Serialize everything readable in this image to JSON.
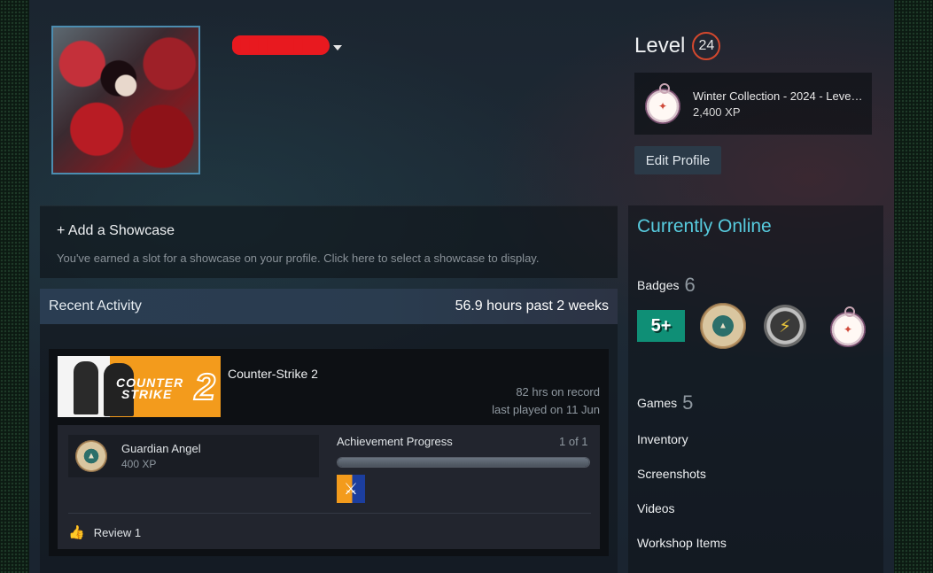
{
  "header": {
    "username": "████████",
    "level_label": "Level",
    "level_value": "24",
    "featured_badge": {
      "name": "Winter Collection - 2024 - Leve…",
      "xp": "2,400 XP",
      "icon": "compass-icon"
    },
    "edit_profile_label": "Edit Profile"
  },
  "showcase": {
    "title": "+ Add a Showcase",
    "description": "You've earned a slot for a showcase on your profile. Click here to select a showcase to display."
  },
  "recent_activity": {
    "title": "Recent Activity",
    "hours_summary": "56.9 hours past 2 weeks",
    "game": {
      "name": "Counter-Strike 2",
      "hours_on_record": "82 hrs on record",
      "last_played": "last played on 11 Jun",
      "capsule_logo_line1": "COUNTER",
      "capsule_logo_line2": "STRIKE",
      "capsule_logo_num": "2",
      "achievement": {
        "name": "Guardian Angel",
        "xp": "400 XP"
      },
      "progress_label": "Achievement Progress",
      "progress_count": "1 of 1",
      "progress_fraction": 1.0,
      "review_label": "Review 1"
    }
  },
  "sidebar": {
    "status": "Currently Online",
    "badges_label": "Badges",
    "badges_count": "6",
    "badge_fiveplus": "5+",
    "games_label": "Games",
    "games_count": "5",
    "links": [
      "Inventory",
      "Screenshots",
      "Videos",
      "Workshop Items"
    ]
  },
  "colors": {
    "online": "#57cbde",
    "level_ring": "#d3482e",
    "badge_teal": "#0f8f76"
  }
}
